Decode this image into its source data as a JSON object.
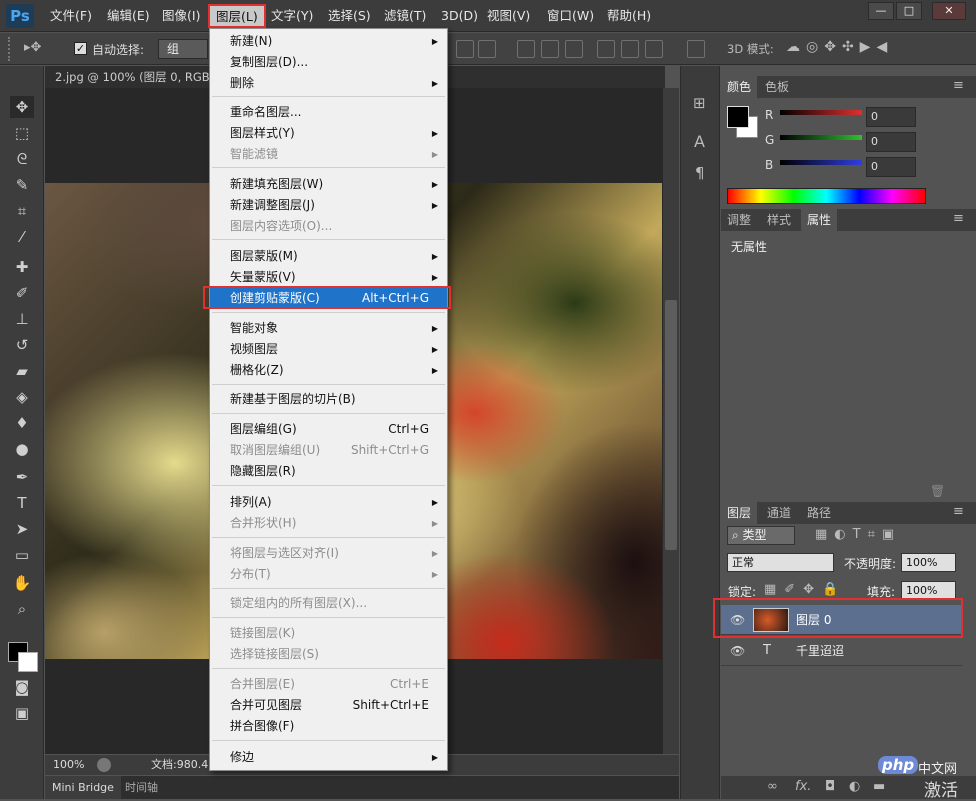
{
  "app": {
    "logo": "Ps",
    "window_buttons": [
      "—",
      "□",
      "✕"
    ]
  },
  "menubar": {
    "items": [
      "文件(F)",
      "编辑(E)",
      "图像(I)",
      "图层(L)",
      "文字(Y)",
      "选择(S)",
      "滤镜(T)",
      "3D(D)",
      "视图(V)",
      "窗口(W)",
      "帮助(H)"
    ]
  },
  "options_bar": {
    "auto_select_label": "自动选择:",
    "auto_select_value": "组",
    "mode_3d_label": "3D 模式:"
  },
  "document": {
    "tab_title": "2.jpg @ 100% (图层 0, RGB/8",
    "zoom": "100%",
    "doc_size": "文档:980.4"
  },
  "bottom_tabs": [
    "Mini Bridge",
    "时间轴"
  ],
  "layer_menu": {
    "items": [
      {
        "label": "新建(N)",
        "submenu": true
      },
      {
        "label": "复制图层(D)..."
      },
      {
        "label": "删除",
        "submenu": true
      },
      {
        "label": "重命名图层..."
      },
      {
        "label": "图层样式(Y)",
        "submenu": true
      },
      {
        "label": "智能滤镜",
        "disabled": true,
        "submenu": true
      },
      {
        "label": "新建填充图层(W)",
        "submenu": true
      },
      {
        "label": "新建调整图层(J)",
        "submenu": true
      },
      {
        "label": "图层内容选项(O)...",
        "disabled": true
      },
      {
        "label": "图层蒙版(M)",
        "submenu": true
      },
      {
        "label": "矢量蒙版(V)",
        "submenu": true
      },
      {
        "label": "创建剪贴蒙版(C)",
        "shortcut": "Alt+Ctrl+G",
        "highlighted": true
      },
      {
        "label": "智能对象",
        "submenu": true
      },
      {
        "label": "视频图层",
        "submenu": true
      },
      {
        "label": "栅格化(Z)",
        "submenu": true
      },
      {
        "label": "新建基于图层的切片(B)"
      },
      {
        "label": "图层编组(G)",
        "shortcut": "Ctrl+G"
      },
      {
        "label": "取消图层编组(U)",
        "shortcut": "Shift+Ctrl+G",
        "disabled": true
      },
      {
        "label": "隐藏图层(R)"
      },
      {
        "label": "排列(A)",
        "submenu": true
      },
      {
        "label": "合并形状(H)",
        "disabled": true,
        "submenu": true
      },
      {
        "label": "将图层与选区对齐(I)",
        "disabled": true,
        "submenu": true
      },
      {
        "label": "分布(T)",
        "disabled": true,
        "submenu": true
      },
      {
        "label": "锁定组内的所有图层(X)...",
        "disabled": true
      },
      {
        "label": "链接图层(K)",
        "disabled": true
      },
      {
        "label": "选择链接图层(S)",
        "disabled": true
      },
      {
        "label": "合并图层(E)",
        "shortcut": "Ctrl+E",
        "disabled": true
      },
      {
        "label": "合并可见图层",
        "shortcut": "Shift+Ctrl+E"
      },
      {
        "label": "拼合图像(F)"
      },
      {
        "label": "修边",
        "submenu": true
      }
    ]
  },
  "color_panel": {
    "tabs": [
      "颜色",
      "色板"
    ],
    "r_label": "R",
    "g_label": "G",
    "b_label": "B",
    "r": "0",
    "g": "0",
    "b": "0",
    "colors": {
      "r": "#e0302f",
      "g": "#2fbf2f",
      "b": "#2f3fe0"
    }
  },
  "properties_panel": {
    "tabs": [
      "调整",
      "样式",
      "属性"
    ],
    "content": "无属性"
  },
  "layers_panel": {
    "tabs": [
      "图层",
      "通道",
      "路径"
    ],
    "filter_label": "类型",
    "blend_mode": "正常",
    "opacity_label": "不透明度:",
    "opacity": "100%",
    "lock_label": "锁定:",
    "fill_label": "填充:",
    "fill": "100%",
    "layers": [
      {
        "name": "图层 0",
        "type": "image",
        "selected": true
      },
      {
        "name": "千里迢迢",
        "type": "text"
      }
    ],
    "footer_icons": [
      "link-icon",
      "fx-icon",
      "mask-icon",
      "adjustment-icon",
      "group-icon",
      "new-layer-icon",
      "delete-icon"
    ],
    "fx_label": "fx."
  },
  "watermark": {
    "brand": "php",
    "text": "中文网",
    "activate": "激活"
  }
}
